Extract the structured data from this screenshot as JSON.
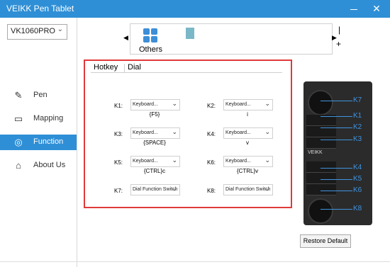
{
  "window": {
    "title": "VEIKK Pen Tablet",
    "minimize": "—",
    "close": "✕"
  },
  "sidebar": {
    "device": "VK1060PRO",
    "items": [
      {
        "label": "Pen",
        "icon": "pen-icon"
      },
      {
        "label": "Mapping",
        "icon": "monitor-icon"
      },
      {
        "label": "Function",
        "icon": "function-icon",
        "active": true
      },
      {
        "label": "About Us",
        "icon": "home-icon"
      }
    ]
  },
  "profiles": {
    "label": "Others",
    "add": "+",
    "remove": "|"
  },
  "tabs": [
    "Hotkey",
    "Dial"
  ],
  "keys": [
    {
      "label": "K1:",
      "select": "Keyboard...",
      "value": "{F5}"
    },
    {
      "label": "K2:",
      "select": "Keyboard...",
      "value": "i"
    },
    {
      "label": "K3:",
      "select": "Keyboard...",
      "value": "{SPACE}"
    },
    {
      "label": "K4:",
      "select": "Keyboard...",
      "value": "v"
    },
    {
      "label": "K5:",
      "select": "Keyboard...",
      "value": "{CTRL}c"
    },
    {
      "label": "K6:",
      "select": "Keyboard...",
      "value": "{CTRL}v"
    },
    {
      "label": "K7:",
      "select": "Dial Function Switch",
      "value": ""
    },
    {
      "label": "K8:",
      "select": "Dial Function Switch",
      "value": ""
    }
  ],
  "tablet": {
    "brand": "VEIKK",
    "labels": [
      "K7",
      "K1",
      "K2",
      "K3",
      "K4",
      "K5",
      "K6",
      "K8"
    ]
  },
  "restore_default": "Restore Default",
  "colors": {
    "titlebar": "#2f8fd6",
    "panel_border": "#e03a3a",
    "accent": "#3f93e0"
  }
}
